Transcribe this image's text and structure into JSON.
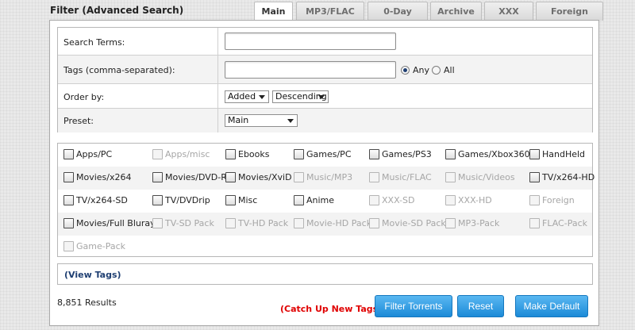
{
  "header": {
    "title": "Filter (Advanced Search)"
  },
  "tabs": [
    {
      "label": "Main",
      "active": true
    },
    {
      "label": "MP3/FLAC",
      "active": false
    },
    {
      "label": "0-Day",
      "active": false
    },
    {
      "label": "Archive",
      "active": false
    },
    {
      "label": "XXX",
      "active": false
    },
    {
      "label": "Foreign",
      "active": false
    }
  ],
  "form": {
    "search_terms": {
      "label": "Search Terms:",
      "value": ""
    },
    "tags": {
      "label": "Tags (comma-separated):",
      "value": "",
      "match_any_label": "Any",
      "match_all_label": "All",
      "selected": "Any"
    },
    "order_by": {
      "label": "Order by:",
      "field": "Added",
      "direction": "Descending"
    },
    "preset": {
      "label": "Preset:",
      "value": "Main"
    }
  },
  "categories": [
    [
      {
        "label": "Apps/PC",
        "enabled": true
      },
      {
        "label": "Apps/misc",
        "enabled": false
      },
      {
        "label": "Ebooks",
        "enabled": true
      },
      {
        "label": "Games/PC",
        "enabled": true
      },
      {
        "label": "Games/PS3",
        "enabled": true
      },
      {
        "label": "Games/Xbox360",
        "enabled": true
      },
      {
        "label": "HandHeld",
        "enabled": true
      }
    ],
    [
      {
        "label": "Movies/x264",
        "enabled": true
      },
      {
        "label": "Movies/DVD-R",
        "enabled": true
      },
      {
        "label": "Movies/XviD",
        "enabled": true
      },
      {
        "label": "Music/MP3",
        "enabled": false
      },
      {
        "label": "Music/FLAC",
        "enabled": false
      },
      {
        "label": "Music/Videos",
        "enabled": false
      },
      {
        "label": "TV/x264-HD",
        "enabled": true
      }
    ],
    [
      {
        "label": "TV/x264-SD",
        "enabled": true
      },
      {
        "label": "TV/DVDrip",
        "enabled": true
      },
      {
        "label": "Misc",
        "enabled": true
      },
      {
        "label": "Anime",
        "enabled": true
      },
      {
        "label": "XXX-SD",
        "enabled": false
      },
      {
        "label": "XXX-HD",
        "enabled": false
      },
      {
        "label": "Foreign",
        "enabled": false
      }
    ],
    [
      {
        "label": "Movies/Full Bluray",
        "enabled": true
      },
      {
        "label": "TV-SD Pack",
        "enabled": false
      },
      {
        "label": "TV-HD Pack",
        "enabled": false
      },
      {
        "label": "Movie-HD Pack",
        "enabled": false
      },
      {
        "label": "Movie-SD Pack",
        "enabled": false
      },
      {
        "label": "MP3-Pack",
        "enabled": false
      },
      {
        "label": "FLAC-Pack",
        "enabled": false
      }
    ],
    [
      {
        "label": "Game-Pack",
        "enabled": false
      }
    ]
  ],
  "view_tags_label": "(View Tags)",
  "results_text": "8,851 Results",
  "catch_up_label": "(Catch Up New Tags)",
  "buttons": {
    "filter": "Filter Torrents",
    "reset": "Reset",
    "make_default": "Make Default"
  },
  "colors": {
    "button_blue": "#1b8ad7",
    "link_blue": "#1f3f72",
    "catch_up_red": "#e00000"
  }
}
